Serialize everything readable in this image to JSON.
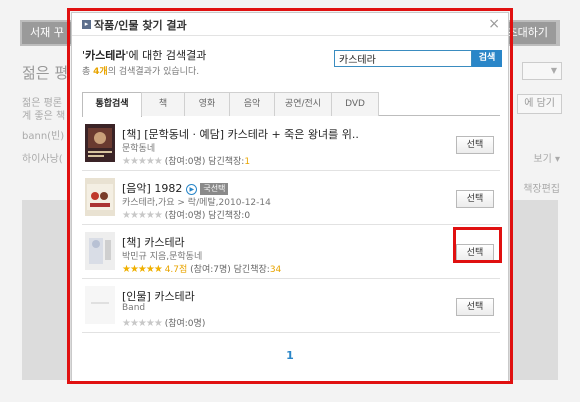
{
  "background": {
    "top_button_left": "서재 꾸",
    "top_button_right": "초대하기",
    "title": "젊은 평",
    "line1": "젊은 평론",
    "line2": "계 좋은 책",
    "line3": "bann(빈)",
    "line4": "하이사낭(",
    "wish_button": "에 담기",
    "link1": "보기 ▾",
    "link2": "책장편집"
  },
  "modal": {
    "title": "작품/인물 찾기 결과",
    "close_label": "×",
    "result_query": "카스테라",
    "result_heading_suffix": "에 대한 검색결과",
    "result_count_prefix": "총 ",
    "result_count": "4개",
    "result_count_suffix": "의 검색결과가 있습니다.",
    "search_value": "카스테라",
    "search_button": "검색",
    "tabs": [
      {
        "label": "통합검색",
        "active": true
      },
      {
        "label": "책",
        "active": false
      },
      {
        "label": "영화",
        "active": false
      },
      {
        "label": "음악",
        "active": false
      },
      {
        "label": "공연/전시",
        "active": false
      },
      {
        "label": "DVD",
        "active": false
      }
    ],
    "items": [
      {
        "title": "[책] [문학동네 · 예담] 카스테라 + 죽은 왕녀를 위..",
        "sub": "문학동네",
        "rating": 0,
        "score": "",
        "meta_text": "(참여:0명) 담긴책장:",
        "shelf_count": "1",
        "select_label": "선택"
      },
      {
        "title": "[음악] 1982",
        "badge": "국선택",
        "sub": "카스테라,가요 > 락/메탈,2010-12-14",
        "rating": 0,
        "score": "",
        "meta_text": "(참여:0명) 담긴책장:0",
        "shelf_count": "",
        "select_label": "선택"
      },
      {
        "title": "[책] 카스테라",
        "sub": "박민규 지음,문학동네",
        "rating": 4.7,
        "score": "4.7점",
        "meta_text": "(참여:7명) 담긴책장:",
        "shelf_count": "34",
        "select_label": "선택"
      },
      {
        "title": "[인물] 카스테라",
        "sub": "Band",
        "rating": 0,
        "score": "",
        "meta_text": "(참여:0명)",
        "shelf_count": "",
        "select_label": "선택"
      }
    ],
    "pagination": "1"
  },
  "colors": {
    "accent": "#2a86c8",
    "highlight_red": "#e01010",
    "rating_star": "#f0b000"
  }
}
